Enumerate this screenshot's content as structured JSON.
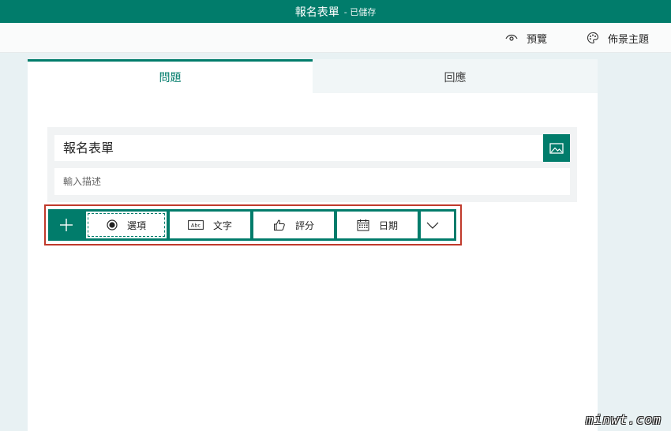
{
  "app": {
    "title": "報名表單",
    "save_status": "- 已儲存"
  },
  "toolbar": {
    "preview_label": "預覽",
    "theme_label": "佈景主題"
  },
  "tabs": [
    {
      "label": "問題",
      "active": true
    },
    {
      "label": "回應",
      "active": false
    }
  ],
  "form": {
    "title_value": "報名表單",
    "description_placeholder": "輸入描述"
  },
  "add_question": {
    "options": [
      {
        "label": "選項",
        "icon": "radio-icon"
      },
      {
        "label": "文字",
        "icon": "text-abc-icon"
      },
      {
        "label": "評分",
        "icon": "thumbs-up-icon"
      },
      {
        "label": "日期",
        "icon": "calendar-icon"
      }
    ]
  },
  "watermark": "minwt.com",
  "colors": {
    "brand": "#017c6b",
    "highlight": "#c0392b",
    "background": "#e8f1f3"
  }
}
